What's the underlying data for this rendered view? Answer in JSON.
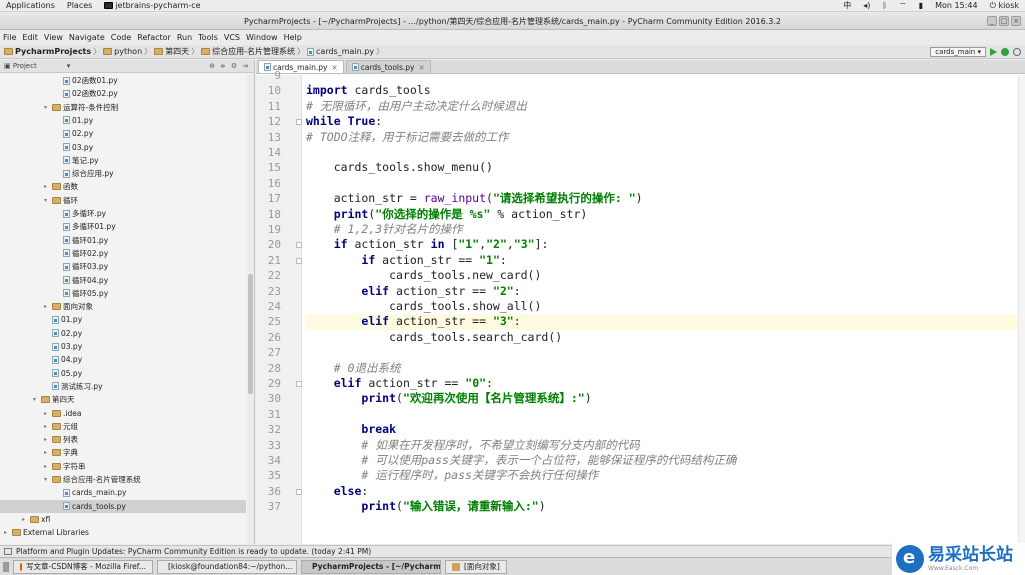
{
  "topbar": {
    "applications": "Applications",
    "places": "Places",
    "app_name": "jetbrains-pycharm-ce",
    "lang": "中",
    "clock": "Mon 15:44",
    "user": "kiosk"
  },
  "window": {
    "title": "PycharmProjects - [~/PycharmProjects] - .../python/第四天/综合应用-名片管理系统/cards_main.py - PyCharm Community Edition 2016.3.2"
  },
  "menu": [
    "File",
    "Edit",
    "View",
    "Navigate",
    "Code",
    "Refactor",
    "Run",
    "Tools",
    "VCS",
    "Window",
    "Help"
  ],
  "breadcrumb": [
    "PycharmProjects",
    "python",
    "第四天",
    "综合应用-名片管理系统",
    "cards_main.py"
  ],
  "run_config": "cards_main",
  "project_panel": {
    "title": "Project"
  },
  "tree": [
    {
      "label": "02函数01.py",
      "level": 3,
      "type": "file"
    },
    {
      "label": "02函数02.py",
      "level": 3,
      "type": "file"
    },
    {
      "label": "运算符-条件控制",
      "level": 2,
      "type": "folder",
      "open": true
    },
    {
      "label": "01.py",
      "level": 3,
      "type": "file"
    },
    {
      "label": "02.py",
      "level": 3,
      "type": "file"
    },
    {
      "label": "03.py",
      "level": 3,
      "type": "file"
    },
    {
      "label": "笔记.py",
      "level": 3,
      "type": "file"
    },
    {
      "label": "综合应用.py",
      "level": 3,
      "type": "file"
    },
    {
      "label": "函数",
      "level": 2,
      "type": "folder",
      "open": false
    },
    {
      "label": "循环",
      "level": 2,
      "type": "folder",
      "open": true
    },
    {
      "label": "多循环.py",
      "level": 3,
      "type": "file"
    },
    {
      "label": "多循环01.py",
      "level": 3,
      "type": "file"
    },
    {
      "label": "循环01.py",
      "level": 3,
      "type": "file"
    },
    {
      "label": "循环02.py",
      "level": 3,
      "type": "file"
    },
    {
      "label": "循环03.py",
      "level": 3,
      "type": "file"
    },
    {
      "label": "循环04.py",
      "level": 3,
      "type": "file"
    },
    {
      "label": "循环05.py",
      "level": 3,
      "type": "file"
    },
    {
      "label": "面向对象",
      "level": 2,
      "type": "folder",
      "open": false
    },
    {
      "label": "01.py",
      "level": 2,
      "type": "file"
    },
    {
      "label": "02.py",
      "level": 2,
      "type": "file"
    },
    {
      "label": "03.py",
      "level": 2,
      "type": "file"
    },
    {
      "label": "04.py",
      "level": 2,
      "type": "file"
    },
    {
      "label": "05.py",
      "level": 2,
      "type": "file"
    },
    {
      "label": "测试练习.py",
      "level": 2,
      "type": "file"
    },
    {
      "label": "第四天",
      "level": 1,
      "type": "folder",
      "open": true
    },
    {
      "label": ".idea",
      "level": 2,
      "type": "folder",
      "open": false
    },
    {
      "label": "元组",
      "level": 2,
      "type": "folder",
      "open": false
    },
    {
      "label": "列表",
      "level": 2,
      "type": "folder",
      "open": false
    },
    {
      "label": "字典",
      "level": 2,
      "type": "folder",
      "open": false
    },
    {
      "label": "字符串",
      "level": 2,
      "type": "folder",
      "open": false
    },
    {
      "label": "综合应用-名片管理系统",
      "level": 2,
      "type": "folder",
      "open": true
    },
    {
      "label": "cards_main.py",
      "level": 3,
      "type": "file"
    },
    {
      "label": "cards_tools.py",
      "level": 3,
      "type": "file",
      "selected": true
    },
    {
      "label": "xfl",
      "level": 0,
      "type": "folder",
      "open": false
    },
    {
      "label": "External Libraries",
      "level": -1,
      "type": "lib",
      "open": false
    }
  ],
  "tabs": [
    {
      "label": "cards_main.py",
      "active": true
    },
    {
      "label": "cards_tools.py",
      "active": false
    }
  ],
  "code": [
    {
      "n": "9",
      "t": ""
    },
    {
      "n": "10",
      "t": "import cards_tools"
    },
    {
      "n": "11",
      "t": "# 无限循环，由用户主动决定什么时候退出"
    },
    {
      "n": "12",
      "t": "while True:"
    },
    {
      "n": "13",
      "t": "# TODO注释，用于标记需要去做的工作"
    },
    {
      "n": "14",
      "t": ""
    },
    {
      "n": "15",
      "t": "    cards_tools.show_menu()"
    },
    {
      "n": "16",
      "t": ""
    },
    {
      "n": "17",
      "t": "    action_str = raw_input(\"请选择希望执行的操作: \")"
    },
    {
      "n": "18",
      "t": "    print(\"你选择的操作是 %s\" % action_str)"
    },
    {
      "n": "19",
      "t": "    # 1,2,3针对名片的操作"
    },
    {
      "n": "20",
      "t": "    if action_str in [\"1\",\"2\",\"3\"]:"
    },
    {
      "n": "21",
      "t": "        if action_str == \"1\":"
    },
    {
      "n": "22",
      "t": "            cards_tools.new_card()"
    },
    {
      "n": "23",
      "t": "        elif action_str == \"2\":"
    },
    {
      "n": "24",
      "t": "            cards_tools.show_all()"
    },
    {
      "n": "25",
      "t": "        elif action_str == \"3\":"
    },
    {
      "n": "26",
      "t": "            cards_tools.search_card()"
    },
    {
      "n": "27",
      "t": ""
    },
    {
      "n": "28",
      "t": "    # 0退出系统"
    },
    {
      "n": "29",
      "t": "    elif action_str == \"0\":"
    },
    {
      "n": "30",
      "t": "        print(\"欢迎再次使用【名片管理系统】:\")"
    },
    {
      "n": "31",
      "t": ""
    },
    {
      "n": "32",
      "t": "        break"
    },
    {
      "n": "33",
      "t": "        # 如果在开发程序时，不希望立刻编写分支内部的代码"
    },
    {
      "n": "34",
      "t": "        # 可以使用pass关键字，表示一个占位符，能够保证程序的代码结构正确"
    },
    {
      "n": "35",
      "t": "        # 运行程序时，pass关键字不会执行任何操作"
    },
    {
      "n": "36",
      "t": "    else:"
    },
    {
      "n": "37",
      "t": "        print(\"输入错误，请重新输入:\")"
    }
  ],
  "current_line": "25",
  "status": {
    "message": "Platform and Plugin Updates: PyCharm Community Edition is ready to update. (today 2:41 PM)"
  },
  "taskbar": [
    {
      "label": "写文章-CSDN博客 - Mozilla Firef...",
      "active": false
    },
    {
      "label": "[kiosk@foundation84:~/python...",
      "active": false
    },
    {
      "label": "PycharmProjects - [~/PycharmP...",
      "active": true
    },
    {
      "label": "[面向对象]",
      "active": false
    }
  ],
  "watermark": {
    "title": "易采站长站",
    "url": "Www.Easck.Com"
  },
  "colors": {
    "keyword": "#000080",
    "string": "#008000",
    "comment": "#808080",
    "current_line": "#fffbe0",
    "run": "#2da33a"
  }
}
